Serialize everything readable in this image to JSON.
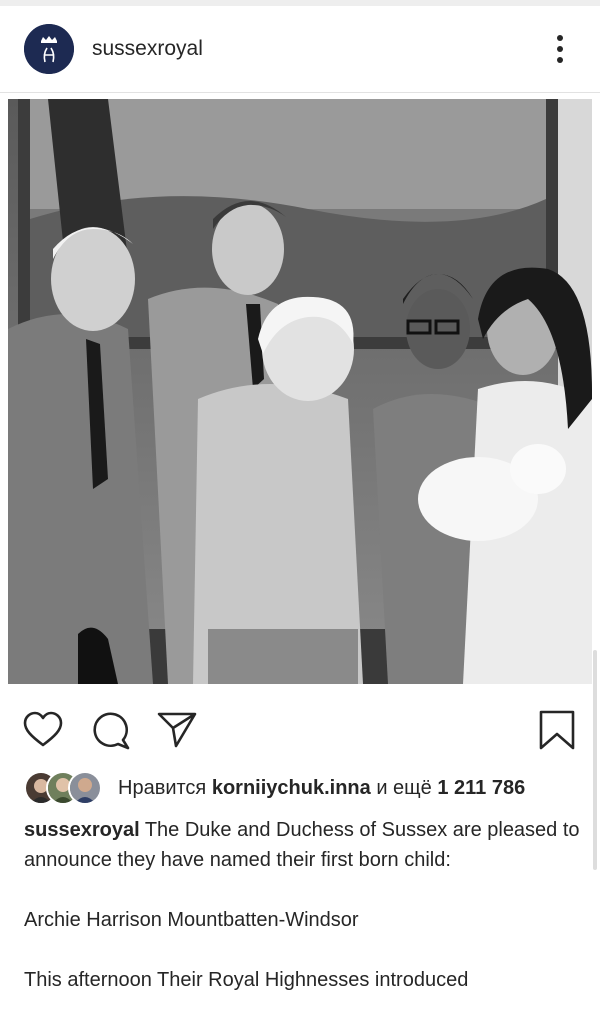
{
  "header": {
    "username": "sussexroyal",
    "avatar_icon": "royal-monogram-icon",
    "menu_icon": "more-vertical-icon"
  },
  "post": {
    "image_alt": "Black and white family photo in a room with a painting",
    "actions": {
      "like_icon": "heart-icon",
      "comment_icon": "comment-icon",
      "share_icon": "send-icon",
      "save_icon": "bookmark-icon"
    },
    "likes": {
      "prefix": "Нравится",
      "user": "korniiychuk.inna",
      "middle": "и ещё",
      "count": "1 211 786"
    },
    "caption": {
      "author": "sussexroyal",
      "text": "The Duke and Duchess of Sussex are pleased to announce they have named their first born child:",
      "name_line": "Archie Harrison Mountbatten-Windsor",
      "next_line": "This afternoon Their Royal Highnesses introduced"
    }
  },
  "colors": {
    "text": "#262626",
    "avatar_bg": "#1d2a52",
    "divider": "#e2e2e2"
  }
}
